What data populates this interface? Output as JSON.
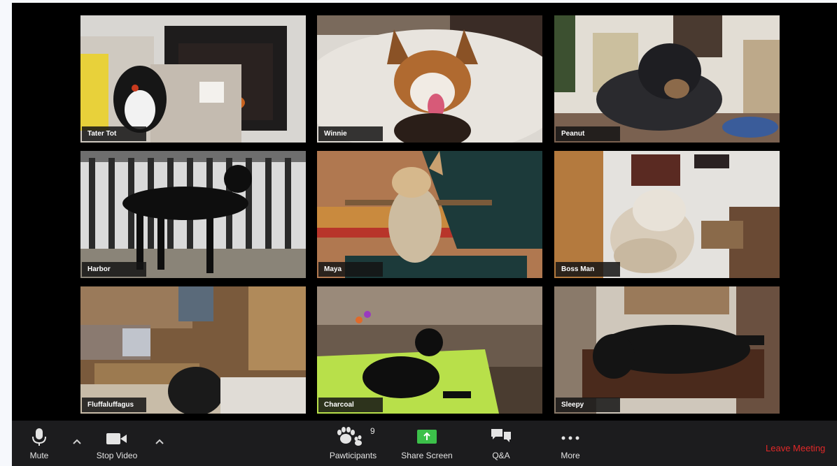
{
  "participants": [
    {
      "name": "Tater Tot"
    },
    {
      "name": "Winnie"
    },
    {
      "name": "Peanut"
    },
    {
      "name": "Harbor"
    },
    {
      "name": "Maya"
    },
    {
      "name": "Boss Man"
    },
    {
      "name": "Fluffaluffagus"
    },
    {
      "name": "Charcoal"
    },
    {
      "name": "Sleepy"
    }
  ],
  "toolbar": {
    "mute_label": "Mute",
    "stop_video_label": "Stop Video",
    "participants_label": "Pawticipants",
    "participants_count": "9",
    "share_label": "Share Screen",
    "qa_label": "Q&A",
    "more_label": "More",
    "leave_label": "Leave Meeting"
  },
  "colors": {
    "toolbar_bg": "#1c1c1e",
    "share_green": "#3cc04a",
    "leave_red": "#e02828"
  }
}
